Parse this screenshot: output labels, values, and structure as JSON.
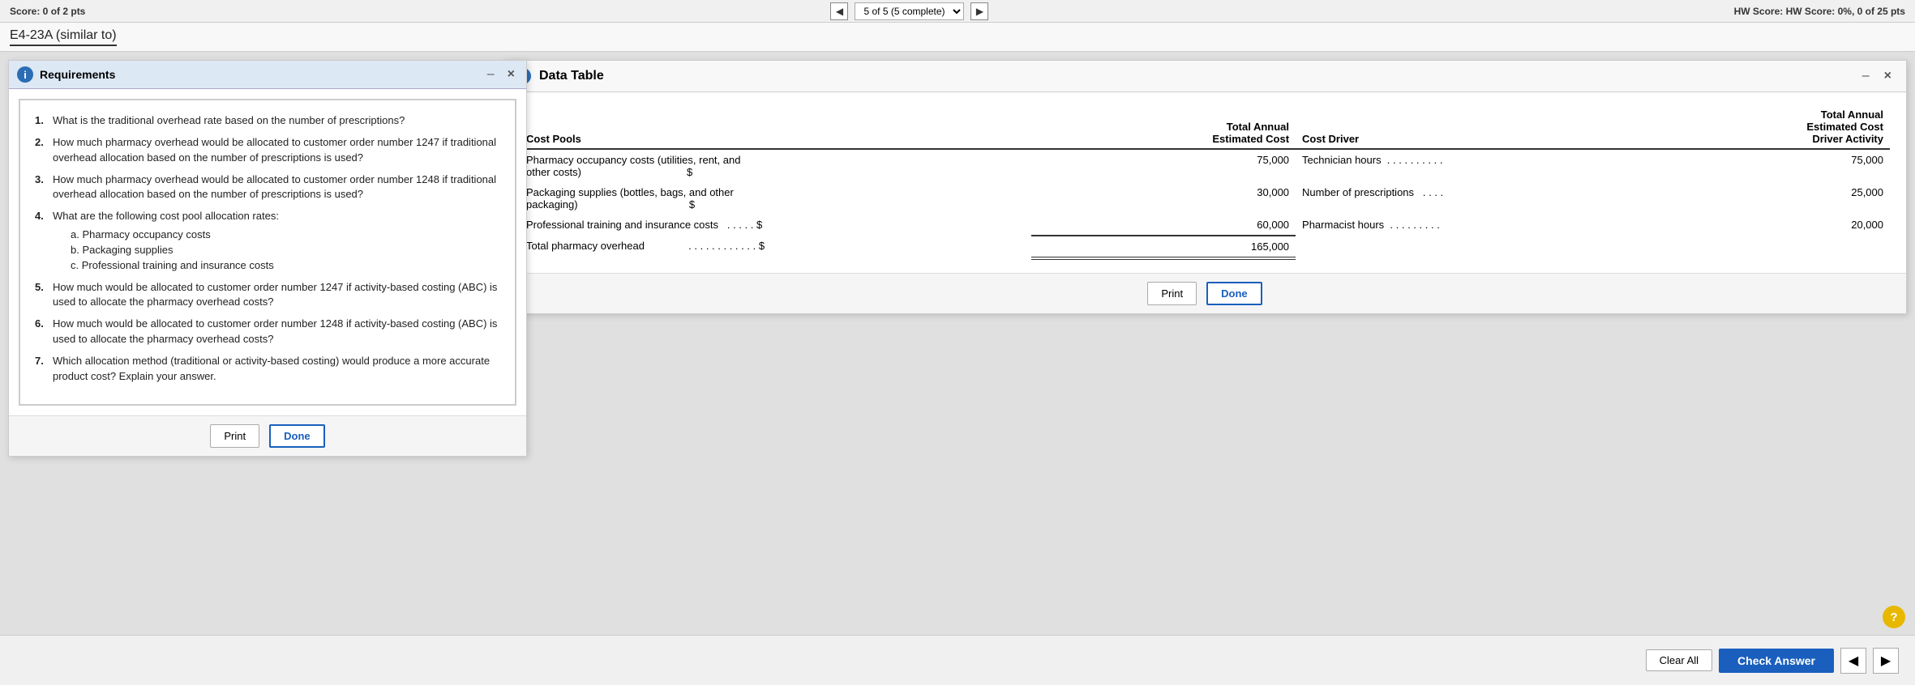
{
  "topBar": {
    "scoreLeft": "Score: 0 of 2 pts",
    "questionNav": "5 of 5 (5 complete)",
    "scoreRight": "HW Score: 0%, 0 of 25 pts"
  },
  "tabLabel": "E4-23A (similar to)",
  "requirementsPanel": {
    "title": "Requirements",
    "minimizeLabel": "–",
    "closeLabel": "×",
    "items": [
      {
        "num": "1.",
        "text": "What is the traditional overhead rate based on the number of prescriptions?"
      },
      {
        "num": "2.",
        "text": "How much pharmacy overhead would be allocated to customer order number 1247 if traditional overhead allocation based on the number of prescriptions is used?"
      },
      {
        "num": "3.",
        "text": "How much pharmacy overhead would be allocated to customer order number 1248 if traditional overhead allocation based on the number of prescriptions is used?"
      },
      {
        "num": "4.",
        "text": "What are the following cost pool allocation rates:",
        "subItems": [
          "a. Pharmacy occupancy costs",
          "b. Packaging supplies",
          "c. Professional training and insurance costs"
        ]
      },
      {
        "num": "5.",
        "text": "How much would be allocated to customer order number 1247 if activity-based costing (ABC) is used to allocate the pharmacy overhead costs?"
      },
      {
        "num": "6.",
        "text": "How much would be allocated to customer order number 1248 if activity-based costing (ABC) is used to allocate the pharmacy overhead costs?"
      },
      {
        "num": "7.",
        "text": "Which allocation method (traditional or activity-based costing) would produce a more accurate product cost? Explain your answer."
      }
    ],
    "printLabel": "Print",
    "doneLabel": "Done"
  },
  "dataTablePanel": {
    "title": "Data Table",
    "minimizeLabel": "–",
    "closeLabel": "×",
    "infoIcon": "i",
    "tableHeaders": {
      "costPools": "Cost Pools",
      "totalAnnualEstimatedCost": "Total Annual\nEstimated Cost",
      "costDriver": "Cost Driver",
      "totalAnnualEstimatedCostDriverActivity": "Total Annual\nEstimated Cost\nDriver Activity"
    },
    "rows": [
      {
        "description": "Pharmacy occupancy costs (utilities, rent, and other costs)",
        "dots": "…………………………………",
        "currencySymbol": "$",
        "amount": "75,000",
        "costDriver": "Technician hours …………",
        "driverAmount": "75,000"
      },
      {
        "description": "Packaging supplies (bottles, bags, and other packaging)",
        "dots": "…………………………………",
        "currencySymbol": "$",
        "amount": "30,000",
        "costDriver": "Number of prescriptions ……",
        "driverAmount": "25,000"
      },
      {
        "description": "Professional training and insurance costs",
        "dots": "………",
        "currencySymbol": "$",
        "amount": "60,000",
        "costDriver": "Pharmacist hours …………",
        "driverAmount": "20,000"
      },
      {
        "description": "Total pharmacy overhead",
        "dots": "……………",
        "currencySymbol": "$",
        "amount": "165,000",
        "costDriver": "",
        "driverAmount": ""
      }
    ],
    "printLabel": "Print",
    "doneLabel": "Done"
  },
  "bottomBar": {
    "clearAllLabel": "Clear All",
    "checkAnswerLabel": "Check Answer",
    "prevArrow": "◀",
    "nextArrow": "▶"
  }
}
